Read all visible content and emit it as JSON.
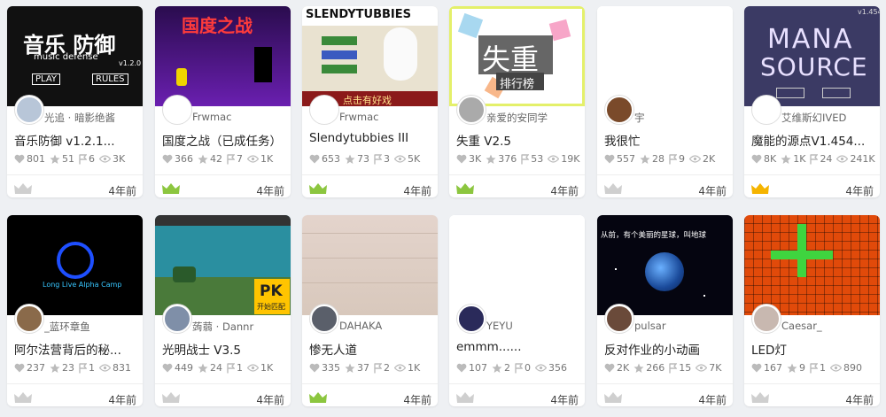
{
  "cards": [
    {
      "thumb": {
        "l1": "音乐 防御",
        "l2": "music    defense",
        "l3": "v1.2.0",
        "b1": "PLAY",
        "b2": "RULES"
      },
      "author": "光追 · 暗影绝酱",
      "title": "音乐防御 v1.2.1...",
      "likes": "801",
      "stars": "51",
      "forks": "6",
      "views": "3K",
      "age": "4年前",
      "crown": "gray"
    },
    {
      "thumb": {
        "l1": "国度之战"
      },
      "author": "Frwmac",
      "title": "国度之战（已成任务）",
      "likes": "366",
      "stars": "42",
      "forks": "7",
      "views": "1K",
      "age": "4年前",
      "crown": "green"
    },
    {
      "thumb": {
        "l1": "SLENDYTUBBIES",
        "l2": "点击有好戏"
      },
      "author": "Frwmac",
      "title": "Slendytubbies III",
      "likes": "653",
      "stars": "73",
      "forks": "3",
      "views": "5K",
      "age": "4年前",
      "crown": "green"
    },
    {
      "thumb": {
        "l1": "失重",
        "l2": "排行榜"
      },
      "author": "亲爱的安同学",
      "title": "失重 V2.5",
      "likes": "3K",
      "stars": "376",
      "forks": "53",
      "views": "19K",
      "age": "4年前",
      "crown": "green"
    },
    {
      "thumb": {},
      "author": "宇",
      "title": "我很忙",
      "likes": "557",
      "stars": "28",
      "forks": "9",
      "views": "2K",
      "age": "4年前",
      "crown": "gray"
    },
    {
      "thumb": {
        "l1": "MANA",
        "l2": "SOURCE",
        "l3": "v1.454"
      },
      "author": "艾维斯幻IVED",
      "title": "魔能的源点V1.454...",
      "likes": "8K",
      "stars": "1K",
      "forks": "24",
      "views": "241K",
      "age": "4年前",
      "crown": "gold"
    },
    {
      "thumb": {
        "l1": "Long Live Alpha Camp"
      },
      "author": "_蓝环章鱼",
      "title": "阿尔法营背后的秘...",
      "likes": "237",
      "stars": "23",
      "forks": "1",
      "views": "831",
      "age": "4年前",
      "crown": "gray"
    },
    {
      "thumb": {
        "l1": "PK",
        "l2": "开始匹配"
      },
      "author": "蒟蒻 · Dannr",
      "title": "光明战士 V3.5",
      "likes": "449",
      "stars": "24",
      "forks": "1",
      "views": "1K",
      "age": "4年前",
      "crown": "gray"
    },
    {
      "thumb": {},
      "author": "DAHAKA",
      "title": "惨无人道",
      "likes": "335",
      "stars": "37",
      "forks": "2",
      "views": "1K",
      "age": "4年前",
      "crown": "green"
    },
    {
      "thumb": {},
      "author": "YEYU",
      "title": "emmm......",
      "likes": "107",
      "stars": "2",
      "forks": "0",
      "views": "356",
      "age": "4年前",
      "crown": "gray"
    },
    {
      "thumb": {
        "l1": "从前，有个美丽的星球，叫地球"
      },
      "author": "pulsar",
      "title": "反对作业的小动画",
      "likes": "2K",
      "stars": "266",
      "forks": "15",
      "views": "7K",
      "age": "4年前",
      "crown": "gray"
    },
    {
      "thumb": {},
      "author": "Caesar_",
      "title": "LED灯",
      "likes": "167",
      "stars": "9",
      "forks": "1",
      "views": "890",
      "age": "4年前",
      "crown": "gray"
    }
  ],
  "colors": {
    "crown_gray": "#cfcfcf",
    "crown_green": "#8cc63f",
    "crown_gold": "#f5b400"
  }
}
